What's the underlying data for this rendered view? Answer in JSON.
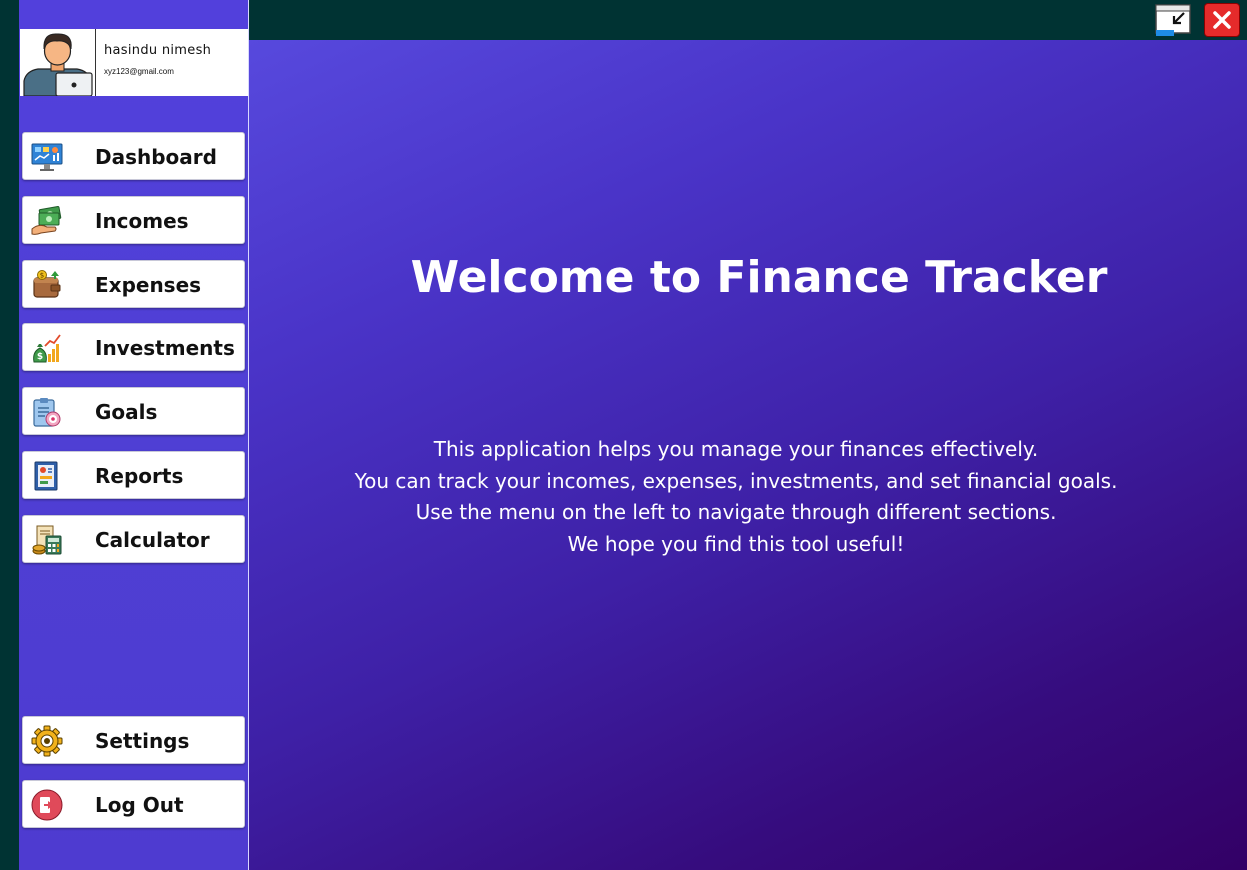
{
  "window": {
    "icons": {
      "restore": "restore-window-icon",
      "close": "close-icon"
    },
    "colors": {
      "background": "#003333",
      "close_button": "#e52b2b"
    }
  },
  "user": {
    "name": "hasindu nimesh",
    "email": "xyz123@gmail.com",
    "avatar_icon": "user-avatar-icon"
  },
  "sidebar": {
    "colors": {
      "background": "#5240dc",
      "button_bg": "#ffffff"
    },
    "items": [
      {
        "label": "Dashboard",
        "icon": "dashboard-icon"
      },
      {
        "label": "Incomes",
        "icon": "income-icon"
      },
      {
        "label": "Expenses",
        "icon": "wallet-icon"
      },
      {
        "label": "Investments",
        "icon": "investment-icon"
      },
      {
        "label": "Goals",
        "icon": "goals-clipboard-icon"
      },
      {
        "label": "Reports",
        "icon": "report-icon"
      },
      {
        "label": "Calculator",
        "icon": "calculator-icon"
      }
    ],
    "bottom_items": [
      {
        "label": "Settings",
        "icon": "gear-icon"
      },
      {
        "label": "Log Out",
        "icon": "logout-icon"
      }
    ]
  },
  "main": {
    "title": "Welcome to Finance Tracker",
    "description_lines": [
      "This application helps you manage your finances effectively.",
      "You can track your incomes, expenses, investments, and set financial goals.",
      "Use the menu on the left to navigate through different sections.",
      "We hope you find this tool useful!"
    ],
    "colors": {
      "gradient_start": "#5749dd",
      "gradient_end": "#330066",
      "text": "#ffffff"
    }
  }
}
